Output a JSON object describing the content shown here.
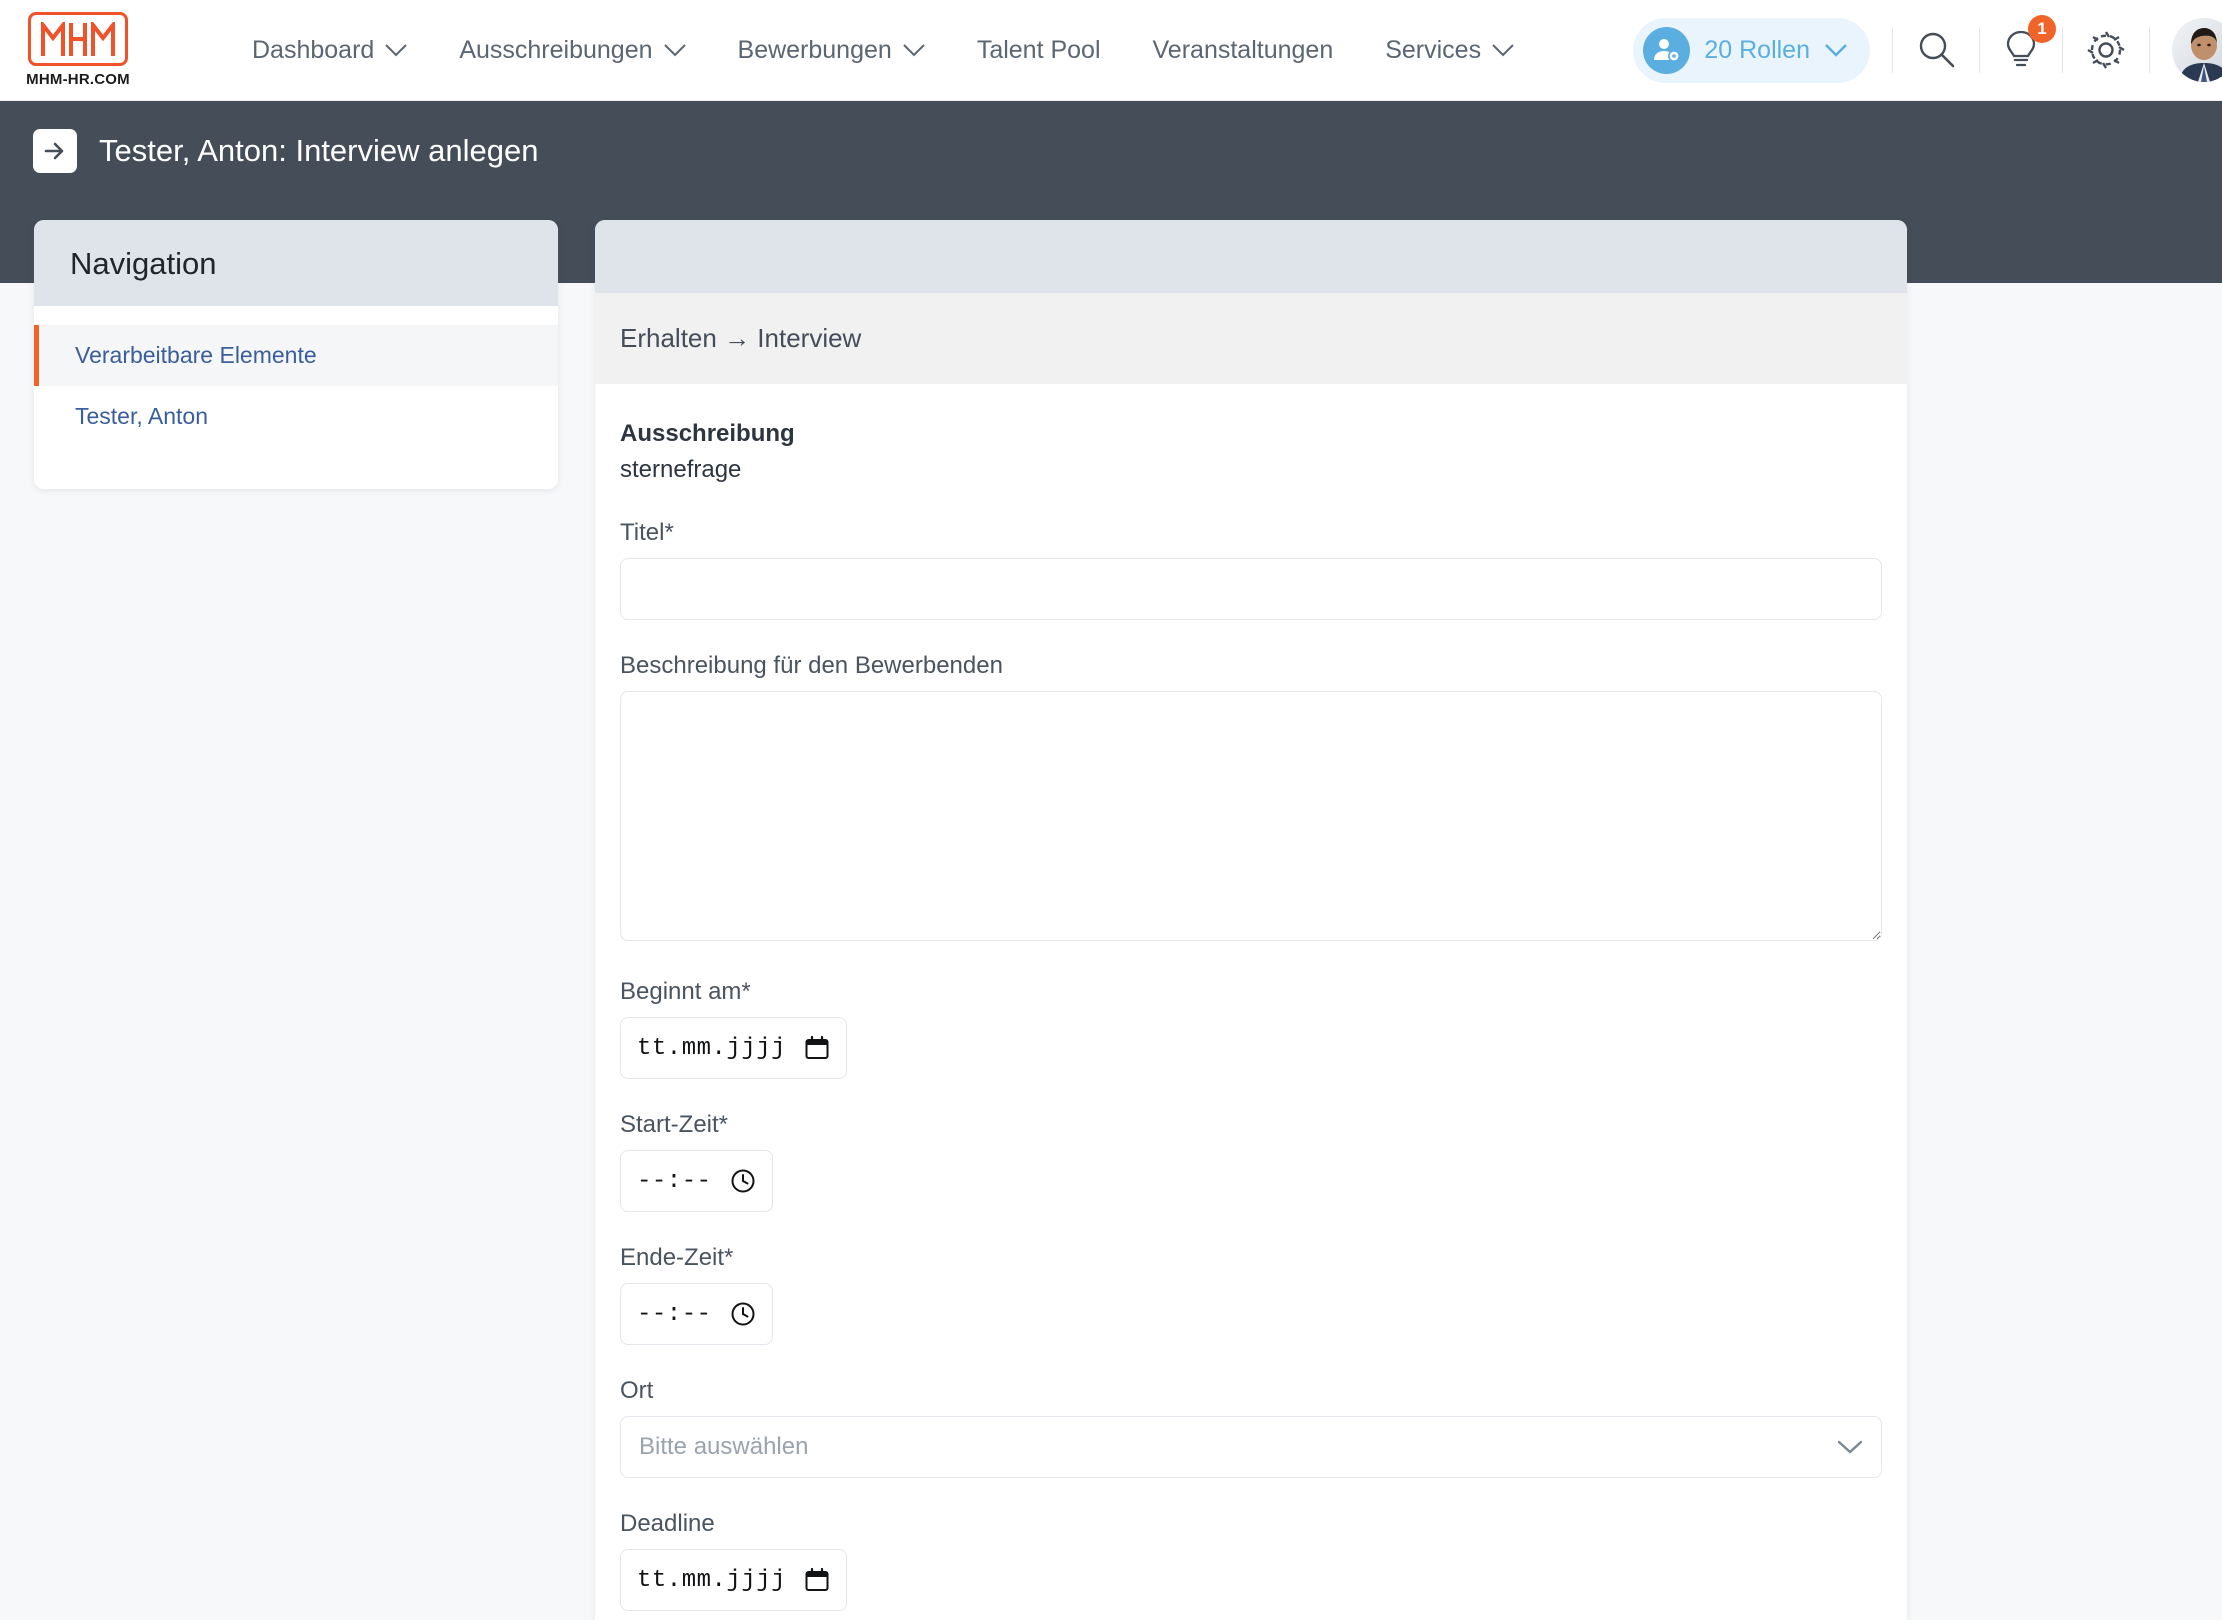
{
  "brand": {
    "logo_letters": "MHM",
    "logo_subtitle": "MHM-HR.COM",
    "accent_orange": "#f0522a",
    "dark_bar": "#454d59",
    "link_blue": "#3a5e9b",
    "roles_blue": "#5aaee0"
  },
  "topnav": {
    "items": [
      {
        "label": "Dashboard",
        "has_chevron": true
      },
      {
        "label": "Ausschreibungen",
        "has_chevron": true
      },
      {
        "label": "Bewerbungen",
        "has_chevron": true
      },
      {
        "label": "Talent Pool",
        "has_chevron": false
      },
      {
        "label": "Veranstaltungen",
        "has_chevron": false
      },
      {
        "label": "Services",
        "has_chevron": true
      }
    ],
    "roles_pill": {
      "label": "20 Rollen",
      "icon": "user-gear-icon"
    },
    "tools": [
      {
        "icon": "search-icon"
      },
      {
        "icon": "lightbulb-icon",
        "badge": "1"
      },
      {
        "icon": "gear-icon"
      }
    ],
    "avatar": {
      "icon": "user-avatar-photo"
    }
  },
  "titlebar": {
    "back_icon": "arrow-right-icon",
    "title": "Tester, Anton: Interview anlegen"
  },
  "sidebar": {
    "header": "Navigation",
    "items": [
      {
        "label": "Verarbeitbare Elemente",
        "active": true
      },
      {
        "label": "Tester, Anton",
        "active": false
      }
    ]
  },
  "main": {
    "breadcrumb": "Erhalten → Interview",
    "ausschreibung_label": "Ausschreibung",
    "ausschreibung_value": "sternefrage",
    "fields": {
      "titel": {
        "label": "Titel*",
        "value": "",
        "placeholder": ""
      },
      "beschreibung": {
        "label": "Beschreibung für den Bewerbenden",
        "value": "",
        "placeholder": ""
      },
      "beginnt_am": {
        "label": "Beginnt am*",
        "placeholder": "tt.mm.jjjj",
        "icon": "calendar-icon"
      },
      "start_zeit": {
        "label": "Start-Zeit*",
        "placeholder": "--:--",
        "icon": "clock-icon"
      },
      "ende_zeit": {
        "label": "Ende-Zeit*",
        "placeholder": "--:--",
        "icon": "clock-icon"
      },
      "ort": {
        "label": "Ort",
        "placeholder": "Bitte auswählen",
        "icon": "chevron-down-icon"
      },
      "deadline": {
        "label": "Deadline",
        "placeholder": "tt.mm.jjjj",
        "icon": "calendar-icon"
      }
    }
  }
}
